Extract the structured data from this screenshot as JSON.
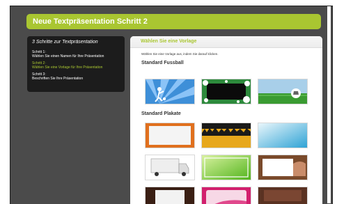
{
  "window": {
    "title": "Neue Textpräsentation Schritt 2"
  },
  "steps": {
    "heading": "3 Schritte zur Textpräsentation",
    "items": [
      {
        "label": "Schritt 1:",
        "desc": "Wählen Sie einen Namen für Ihre Präsentation"
      },
      {
        "label": "Schritt 2:",
        "desc": "Wählen Sie eine Vorlage für Ihre Präsentation"
      },
      {
        "label": "Schritt 3:",
        "desc": "Beschriften Sie Ihre Präsentation"
      }
    ],
    "active_index": 1
  },
  "content": {
    "title": "Wählen Sie eine Vorlage",
    "intro": "Wählen Sie eine Vorlage aus, indem Sie darauf klicken.",
    "sections": [
      {
        "name": "Standard Fussball",
        "templates": [
          "fussball-rays",
          "fussball-bubbles",
          "fussball-ball-field"
        ]
      },
      {
        "name": "Standard Plakate",
        "templates": [
          "plakat-orange-frame",
          "plakat-crowd",
          "plakat-sky",
          "plakat-truck",
          "plakat-green",
          "plakat-hand-card",
          "plakat-dark-board",
          "plakat-pink",
          "plakat-coffee"
        ]
      }
    ]
  },
  "colors": {
    "accent": "#a9c631",
    "background": "#4b4b4b",
    "panel": "#1c1c1c"
  }
}
